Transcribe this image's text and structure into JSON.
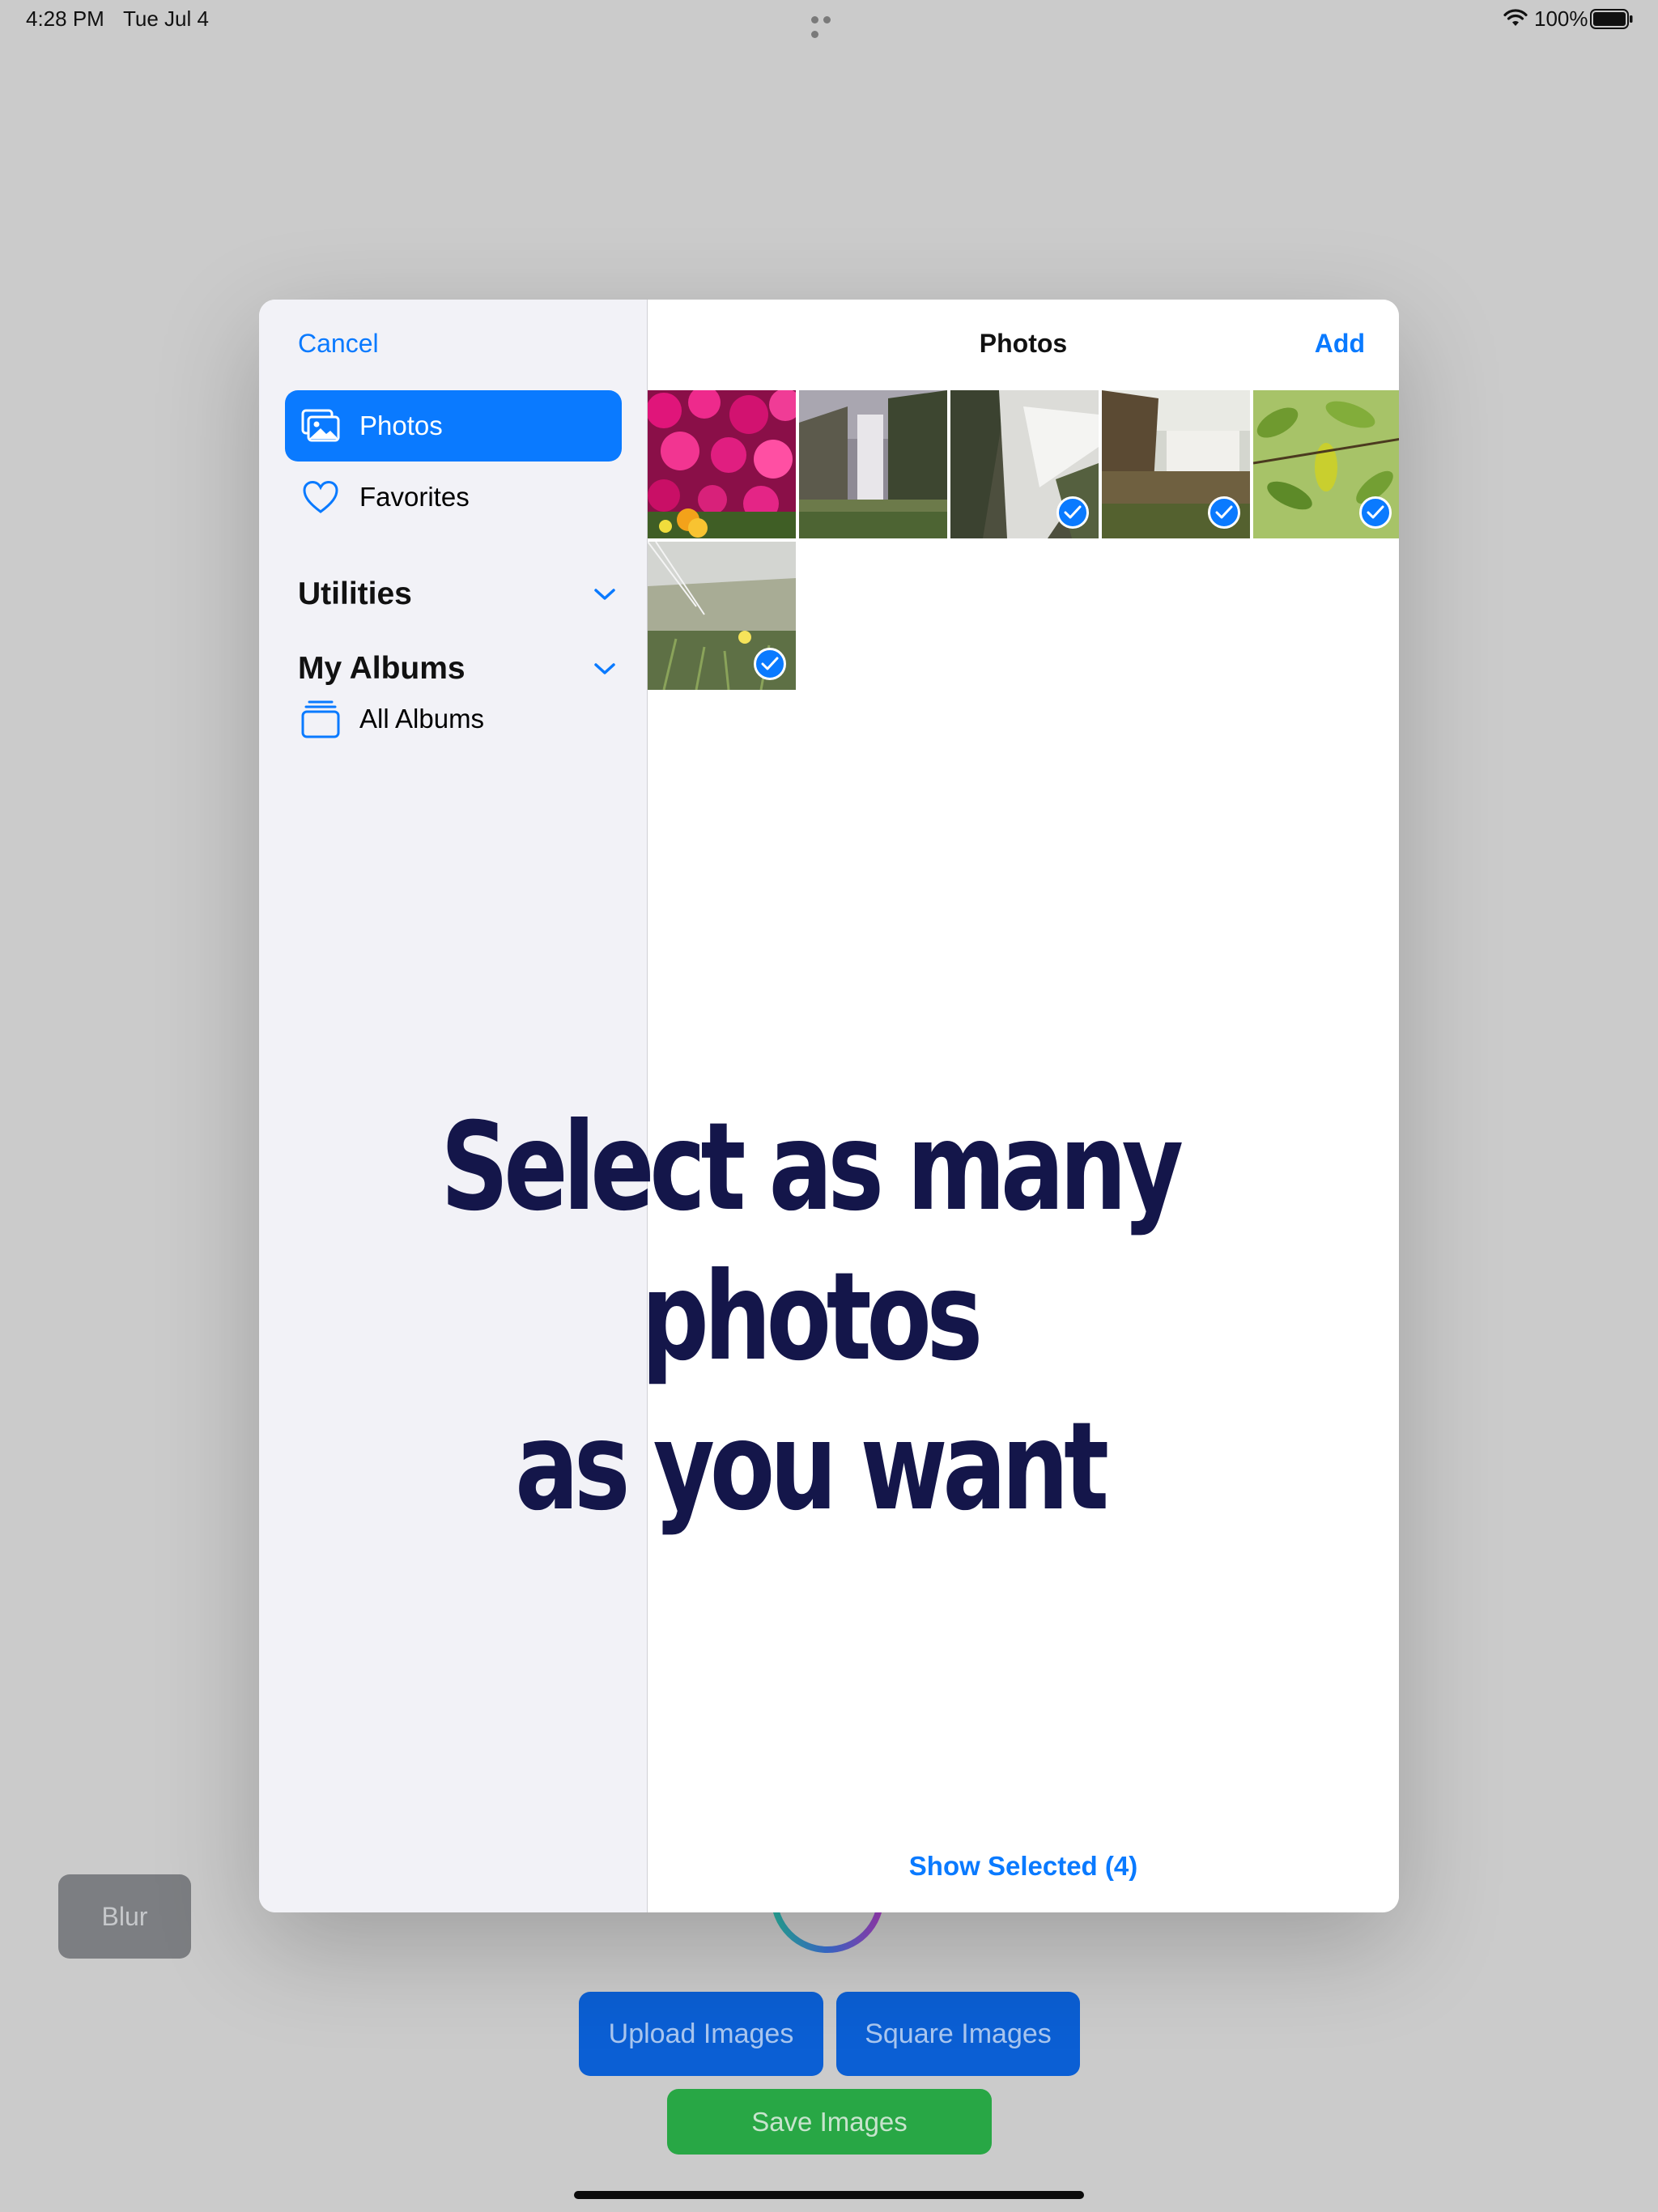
{
  "status_bar": {
    "time": "4:28 PM",
    "date": "Tue Jul 4",
    "battery": "100%"
  },
  "picker": {
    "cancel_label": "Cancel",
    "title": "Photos",
    "add_label": "Add",
    "sidebar": {
      "items": [
        {
          "label": "Photos",
          "icon": "photos-icon",
          "active": true
        },
        {
          "label": "Favorites",
          "icon": "heart-icon",
          "active": false
        }
      ],
      "sections": [
        {
          "label": "Utilities"
        },
        {
          "label": "My Albums"
        }
      ],
      "all_albums_label": "All Albums"
    },
    "photos": [
      {
        "subject": "pink flowers",
        "selected": false
      },
      {
        "subject": "waterfall in mist",
        "selected": false
      },
      {
        "subject": "waterfall on rocks",
        "selected": true
      },
      {
        "subject": "waterfall at sunset",
        "selected": true
      },
      {
        "subject": "green leaves",
        "selected": true
      },
      {
        "subject": "dune grass",
        "selected": true
      }
    ],
    "show_selected_label": "Show Selected (4)"
  },
  "caption": {
    "line1": "Select as many photos",
    "line2": "as you want"
  },
  "background_app": {
    "blur_label": "Blur",
    "upload_label": "Upload Images",
    "square_label": "Square Images",
    "save_label": "Save Images"
  },
  "colors": {
    "accent": "#0a7aff",
    "caption": "#14164a",
    "save_button": "#28a745",
    "upload_button": "#0b5fd4"
  }
}
